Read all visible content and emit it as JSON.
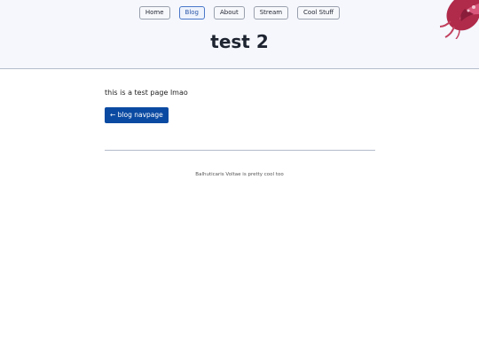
{
  "nav": {
    "items": [
      {
        "label": "Home"
      },
      {
        "label": "Blog"
      },
      {
        "label": "About"
      },
      {
        "label": "Stream"
      },
      {
        "label": "Cool Stuff"
      }
    ]
  },
  "header": {
    "title": "test 2",
    "accent_color": "#b02a4a"
  },
  "main": {
    "body_text": "this is a test page lmao",
    "back_button_label": "← blog navpage",
    "button_color": "#0b4aa2"
  },
  "footer": {
    "text": "Balhuticaris Voltae is pretty cool too"
  }
}
